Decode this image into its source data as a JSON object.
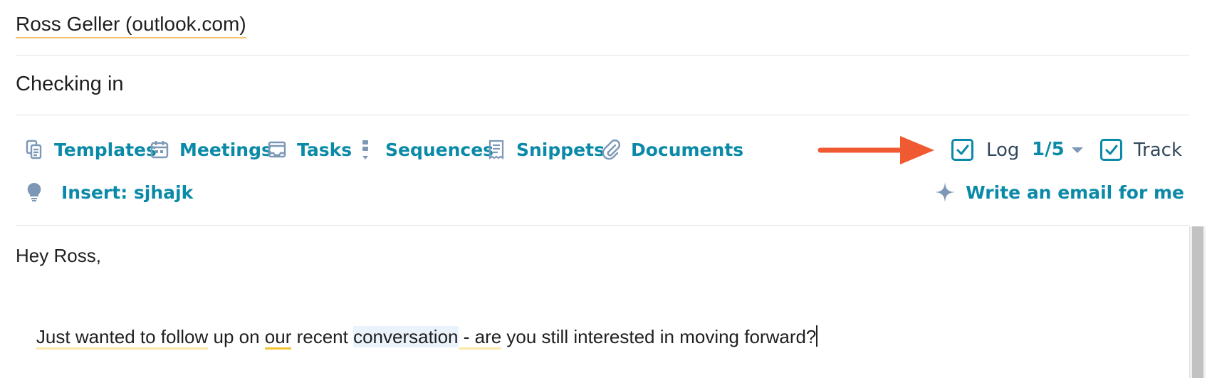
{
  "recipient": {
    "text": "Ross Geller (outlook.com)"
  },
  "subject": {
    "text": "Checking in"
  },
  "toolbar": {
    "items": [
      {
        "label": "Templates",
        "icon": "templates-icon"
      },
      {
        "label": "Meetings",
        "icon": "calendar-icon"
      },
      {
        "label": "Tasks",
        "icon": "tasks-icon"
      },
      {
        "label": "Sequences",
        "icon": "sequences-icon"
      },
      {
        "label": "Snippets",
        "icon": "snippets-icon"
      },
      {
        "label": "Documents",
        "icon": "paperclip-icon"
      }
    ],
    "log": {
      "label": "Log",
      "checked": true,
      "count": "1/5"
    },
    "track": {
      "label": "Track",
      "checked": true
    },
    "insert": {
      "label": "Insert: sjhajk",
      "icon": "lightbulb-icon"
    },
    "ai_write": {
      "label": "Write an email for me",
      "icon": "sparkle-icon"
    }
  },
  "annotation": {
    "arrow_color": "#f05a33"
  },
  "body": {
    "greeting": "Hey Ross,",
    "line2_segments": [
      {
        "text": "Just",
        "style": "u-yellow"
      },
      {
        "text": " wanted to follow",
        "style": "u-yellow"
      },
      {
        "text": " up on ",
        "style": ""
      },
      {
        "text": "our",
        "style": "u-gold"
      },
      {
        "text": " recent ",
        "style": ""
      },
      {
        "text": "conversation",
        "style": "hl-blue"
      },
      {
        "text": " - are",
        "style": "u-yellow"
      },
      {
        "text": " you still interested in moving forward?",
        "style": ""
      }
    ]
  },
  "colors": {
    "accent": "#0b8aa8",
    "text": "#1f1f1f",
    "muted": "#33475b",
    "divider": "#dfe3eb"
  }
}
